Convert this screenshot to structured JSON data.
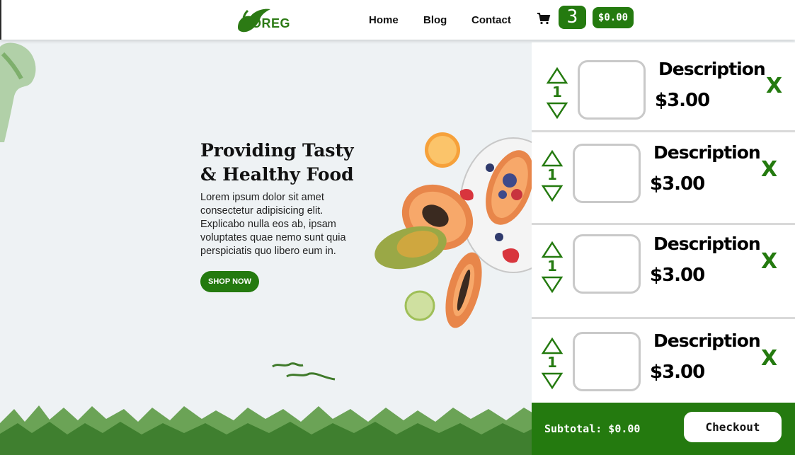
{
  "nav": {
    "logo_text": "OREG",
    "links": [
      "Home",
      "Blog",
      "Contact"
    ],
    "cart_count": "3",
    "cart_total": "$0.00"
  },
  "hero": {
    "title": "Providing Tasty & Healthy Food",
    "text": "Lorem ipsum dolor sit amet consectetur adipisicing elit. Explicabo nulla eos ab, ipsam voluptates quae nemo sunt quia perspiciatis quo libero eum in.",
    "button": "SHOP NOW"
  },
  "cart": {
    "items": [
      {
        "qty": "1",
        "description": "Description",
        "price": "$3.00",
        "remove": "X"
      },
      {
        "qty": "1",
        "description": "Description",
        "price": "$3.00",
        "remove": "X"
      },
      {
        "qty": "1",
        "description": "Description",
        "price": "$3.00",
        "remove": "X"
      },
      {
        "qty": "1",
        "description": "Description",
        "price": "$3.00",
        "remove": "X"
      }
    ],
    "subtotal": "Subtotal: $0.00",
    "checkout": "Checkout"
  },
  "colors": {
    "brand_green": "#247a0f",
    "background": "#eef2f4"
  },
  "icons": [
    "cart-icon",
    "triangle-up-icon",
    "triangle-down-icon"
  ]
}
